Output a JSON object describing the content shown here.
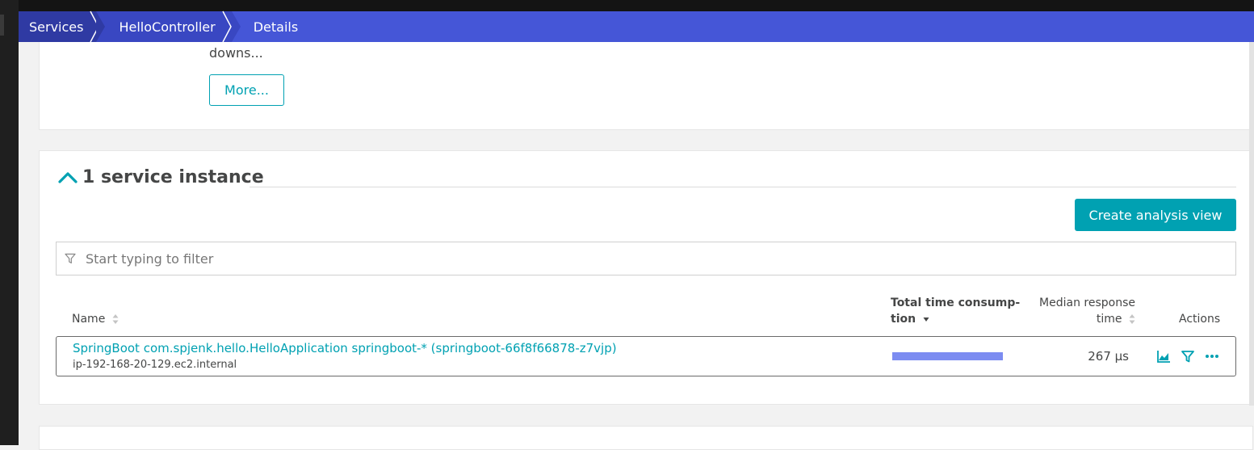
{
  "breadcrumb": {
    "items": [
      {
        "label": "Services"
      },
      {
        "label": "HelloController"
      },
      {
        "label": "Details"
      }
    ]
  },
  "description": {
    "truncated_text": "downs...",
    "more_label": "More..."
  },
  "instances": {
    "title": "1 service instance",
    "create_label": "Create analysis view",
    "filter_placeholder": "Start typing to filter",
    "columns": {
      "name": "Name",
      "total_time": "Total time consump-",
      "total_time_2": "tion",
      "median": "Median response",
      "median_2": "time",
      "actions": "Actions"
    },
    "rows": [
      {
        "name": "SpringBoot com.spjenk.hello.HelloApplication springboot-* (springboot-66f8f66878-z7vjp)",
        "host": "ip-192-168-20-129.ec2.internal",
        "total_time_fraction": 1.0,
        "median": "267 µs"
      }
    ]
  },
  "icons": {
    "expand": "chevron-up-icon",
    "filter": "filter-icon",
    "sort": "sort-icon",
    "sort_desc": "sort-descending-icon",
    "chart": "chart-icon",
    "more": "more-horizontal-icon"
  },
  "colors": {
    "breadcrumb_bg": "#4556d7",
    "accent": "#00a1b2",
    "bar": "#7c8cf1"
  }
}
